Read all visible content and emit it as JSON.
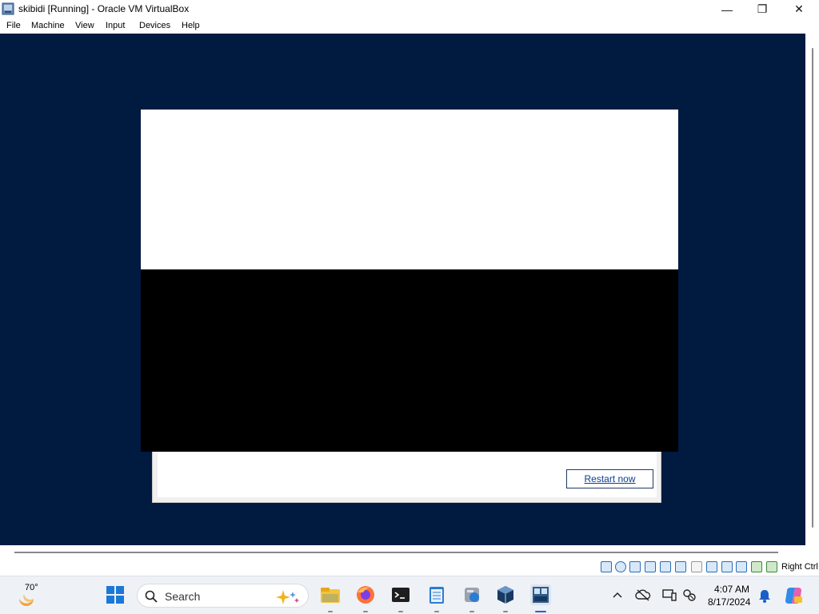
{
  "window": {
    "title": "skibidi [Running] - Oracle VM VirtualBox",
    "minimize": "—",
    "maximize": "❐",
    "close": "✕"
  },
  "menu": [
    "File",
    "Machine",
    "View",
    "Input",
    "Devices",
    "Help"
  ],
  "dialog": {
    "restart_label": "Restart now"
  },
  "statusbar": {
    "host_key": "Right Ctrl",
    "icons": [
      "hard-disk-icon",
      "optical-drive-icon",
      "floppy-icon",
      "audio-icon",
      "network-icon",
      "usb-icon",
      "shared-folders-icon",
      "display-icon",
      "recording-icon",
      "vt-x-icon",
      "guest-additions-icon",
      "mouse-integration-icon"
    ]
  },
  "taskbar": {
    "weather": "70°",
    "search_placeholder": "Search",
    "time": "4:07 AM",
    "date": "8/17/2024",
    "apps": [
      "file-explorer-icon",
      "firefox-icon",
      "terminal-icon",
      "notepad-icon",
      "disk-icon",
      "virtualbox-icon",
      "windows-server-2012-icon"
    ]
  },
  "colors": {
    "vm_background": "#001a40",
    "taskbar": "#eef1f6"
  }
}
